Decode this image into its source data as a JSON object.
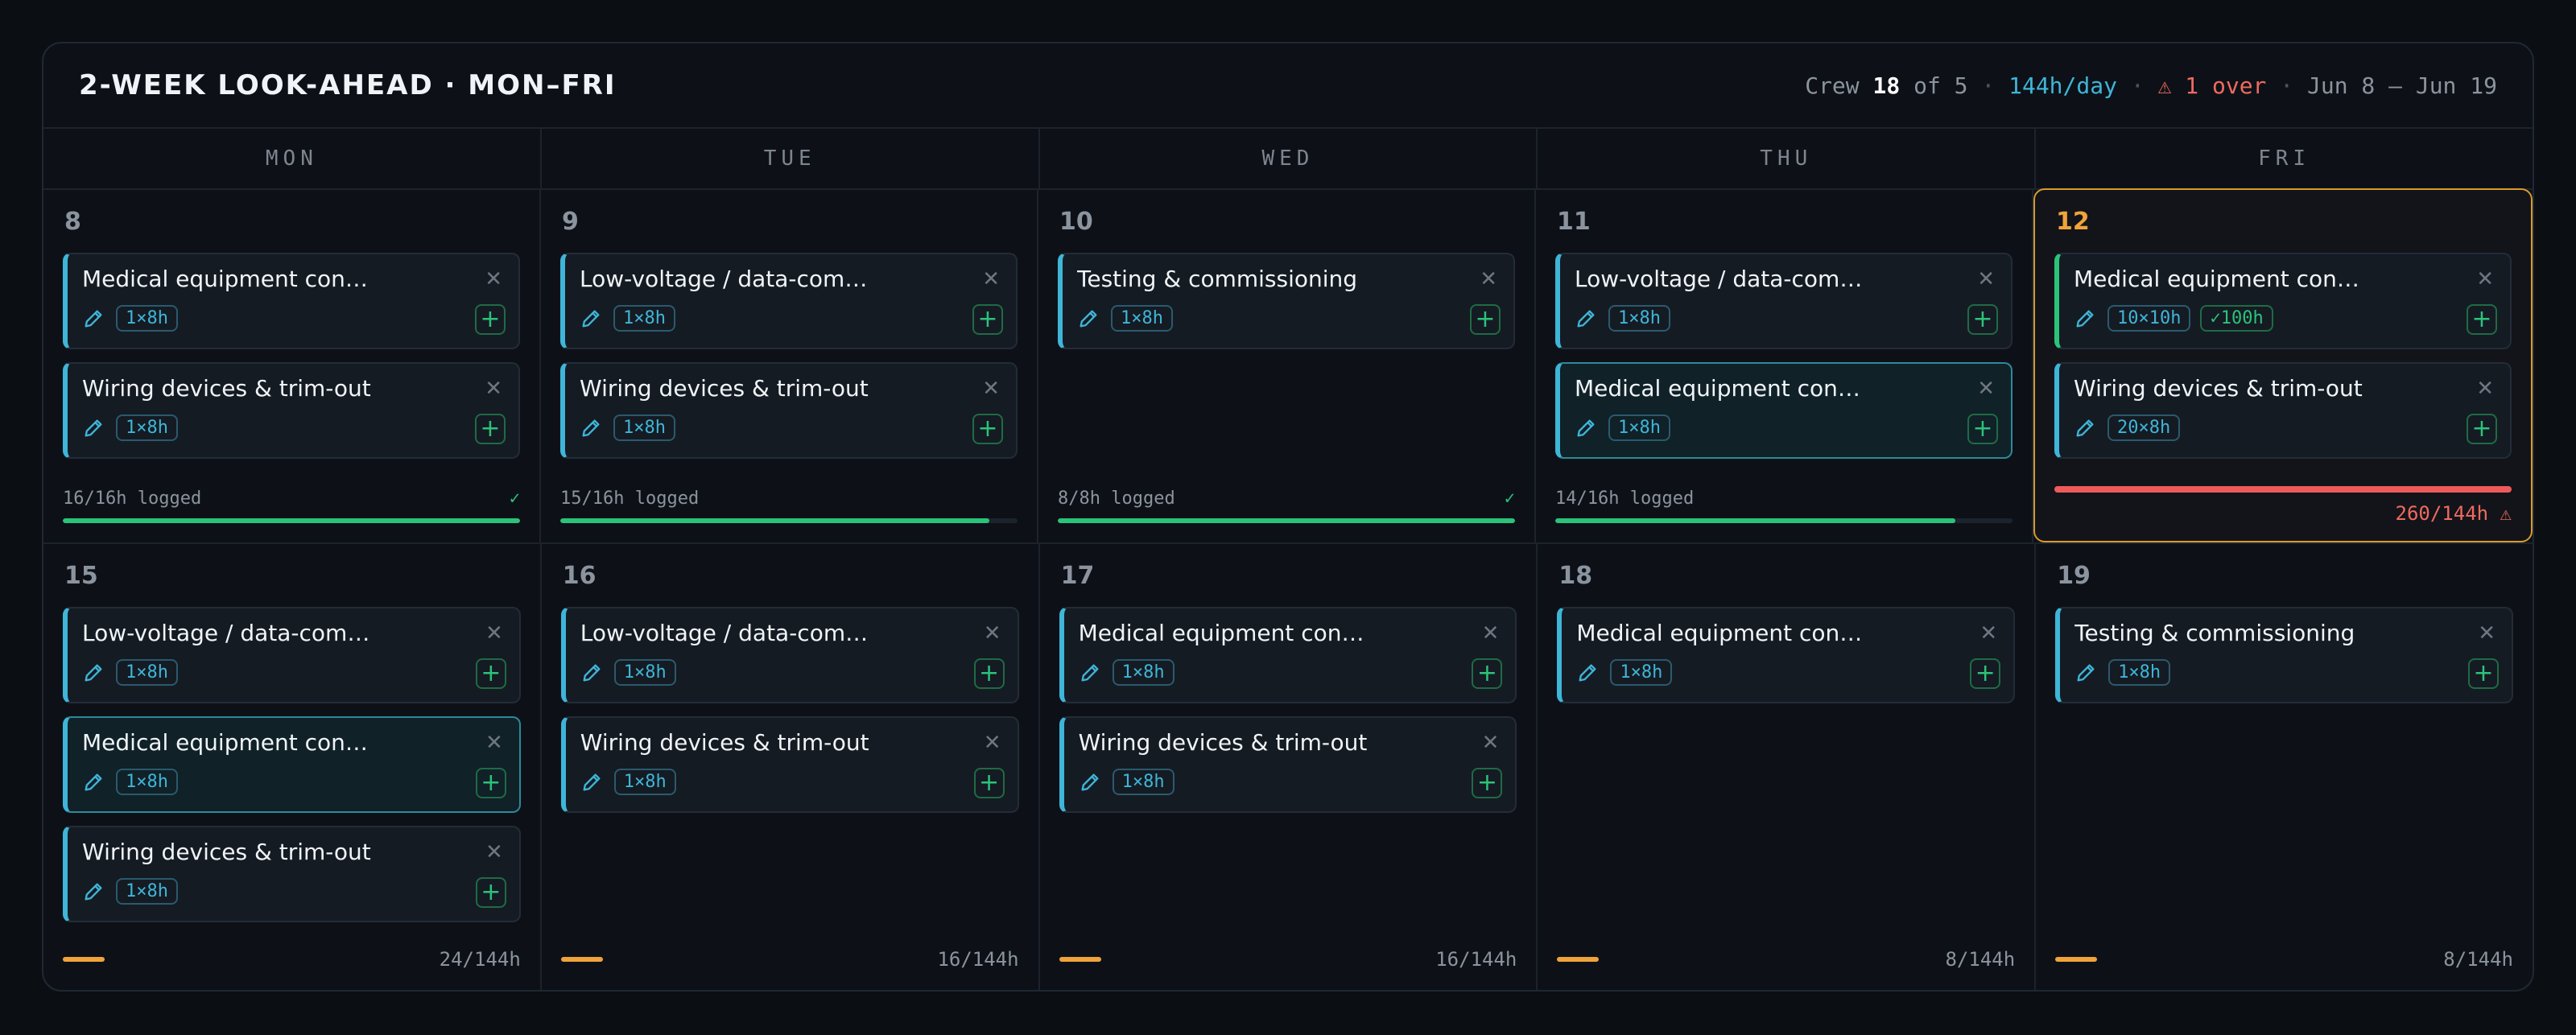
{
  "header": {
    "title": "2-WEEK LOOK-AHEAD · MON–FRI",
    "crew_label": "Crew ",
    "crew_count": "18",
    "crew_of": " of 5",
    "sep": " · ",
    "hours_per_day": "144h/day",
    "over": "⚠ 1 over",
    "date_range": "Jun 8 – Jun 19"
  },
  "weekdays": [
    "MON",
    "TUE",
    "WED",
    "THU",
    "FRI"
  ],
  "week1": [
    {
      "day": "8",
      "tasks": [
        {
          "name": "Medical equipment con…",
          "badge": "1×8h"
        },
        {
          "name": "Wiring devices & trim-out",
          "badge": "1×8h"
        }
      ],
      "logged": "16/16h logged",
      "check": "✓",
      "progress": 1.0
    },
    {
      "day": "9",
      "tasks": [
        {
          "name": "Low-voltage / data-com…",
          "badge": "1×8h"
        },
        {
          "name": "Wiring devices & trim-out",
          "badge": "1×8h"
        }
      ],
      "logged": "15/16h logged",
      "check": "",
      "progress": 0.9375
    },
    {
      "day": "10",
      "tasks": [
        {
          "name": "Testing & commissioning",
          "badge": "1×8h"
        }
      ],
      "logged": "8/8h logged",
      "check": "✓",
      "progress": 1.0
    },
    {
      "day": "11",
      "tasks": [
        {
          "name": "Low-voltage / data-com…",
          "badge": "1×8h"
        },
        {
          "name": "Medical equipment con…",
          "badge": "1×8h"
        }
      ],
      "logged": "14/16h logged",
      "check": "",
      "progress": 0.875
    },
    {
      "day": "12",
      "tasks": [
        {
          "name": "Medical equipment con…",
          "badge": "10×10h",
          "badge2": "✓100h"
        },
        {
          "name": "Wiring devices & trim-out",
          "badge": "20×8h"
        }
      ],
      "capacity": "260/144h ⚠"
    }
  ],
  "week2": [
    {
      "day": "15",
      "tasks": [
        {
          "name": "Low-voltage / data-com…",
          "badge": "1×8h"
        },
        {
          "name": "Medical equipment con…",
          "badge": "1×8h"
        },
        {
          "name": "Wiring devices & trim-out",
          "badge": "1×8h"
        }
      ],
      "capacity": "24/144h"
    },
    {
      "day": "16",
      "tasks": [
        {
          "name": "Low-voltage / data-com…",
          "badge": "1×8h"
        },
        {
          "name": "Wiring devices & trim-out",
          "badge": "1×8h"
        }
      ],
      "capacity": "16/144h"
    },
    {
      "day": "17",
      "tasks": [
        {
          "name": "Medical equipment con…",
          "badge": "1×8h"
        },
        {
          "name": "Wiring devices & trim-out",
          "badge": "1×8h"
        }
      ],
      "capacity": "16/144h"
    },
    {
      "day": "18",
      "tasks": [
        {
          "name": "Medical equipment con…",
          "badge": "1×8h"
        }
      ],
      "capacity": "8/144h"
    },
    {
      "day": "19",
      "tasks": [
        {
          "name": "Testing & commissioning",
          "badge": "1×8h"
        }
      ],
      "capacity": "8/144h"
    }
  ],
  "icons": {
    "edit": "pencil-icon",
    "remove": "close-icon",
    "add": "plus-icon",
    "warning": "warning-icon"
  },
  "colors": {
    "accent": "#3fb5d8",
    "ok": "#2bc37a",
    "warn": "#f0a33a",
    "over": "#ee5a5a"
  }
}
